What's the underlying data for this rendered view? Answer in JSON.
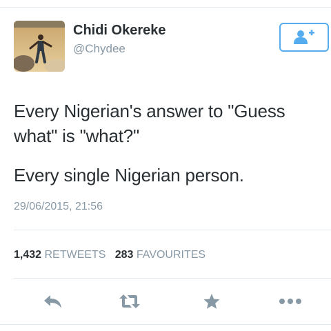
{
  "tweet": {
    "author_name": "Chidi Okereke",
    "author_handle": "@Chydee",
    "text_lines": [
      "Every Nigerian's answer to \"Guess",
      "what\" is \"what?\"",
      "Every single Nigerian person."
    ],
    "timestamp": "29/06/2015, 21:56",
    "retweets_count": "1,432",
    "retweets_label": "RETWEETS",
    "favourites_count": "283",
    "favourites_label": "FAVOURITES"
  },
  "icons": {
    "follow": "add-user-icon",
    "reply": "reply-icon",
    "retweet": "retweet-icon",
    "favourite": "star-icon",
    "more": "more-dots-icon"
  },
  "colors": {
    "accent": "#55acee",
    "muted": "#8899a6",
    "text": "#292f33",
    "action_icon": "#8899a6"
  }
}
